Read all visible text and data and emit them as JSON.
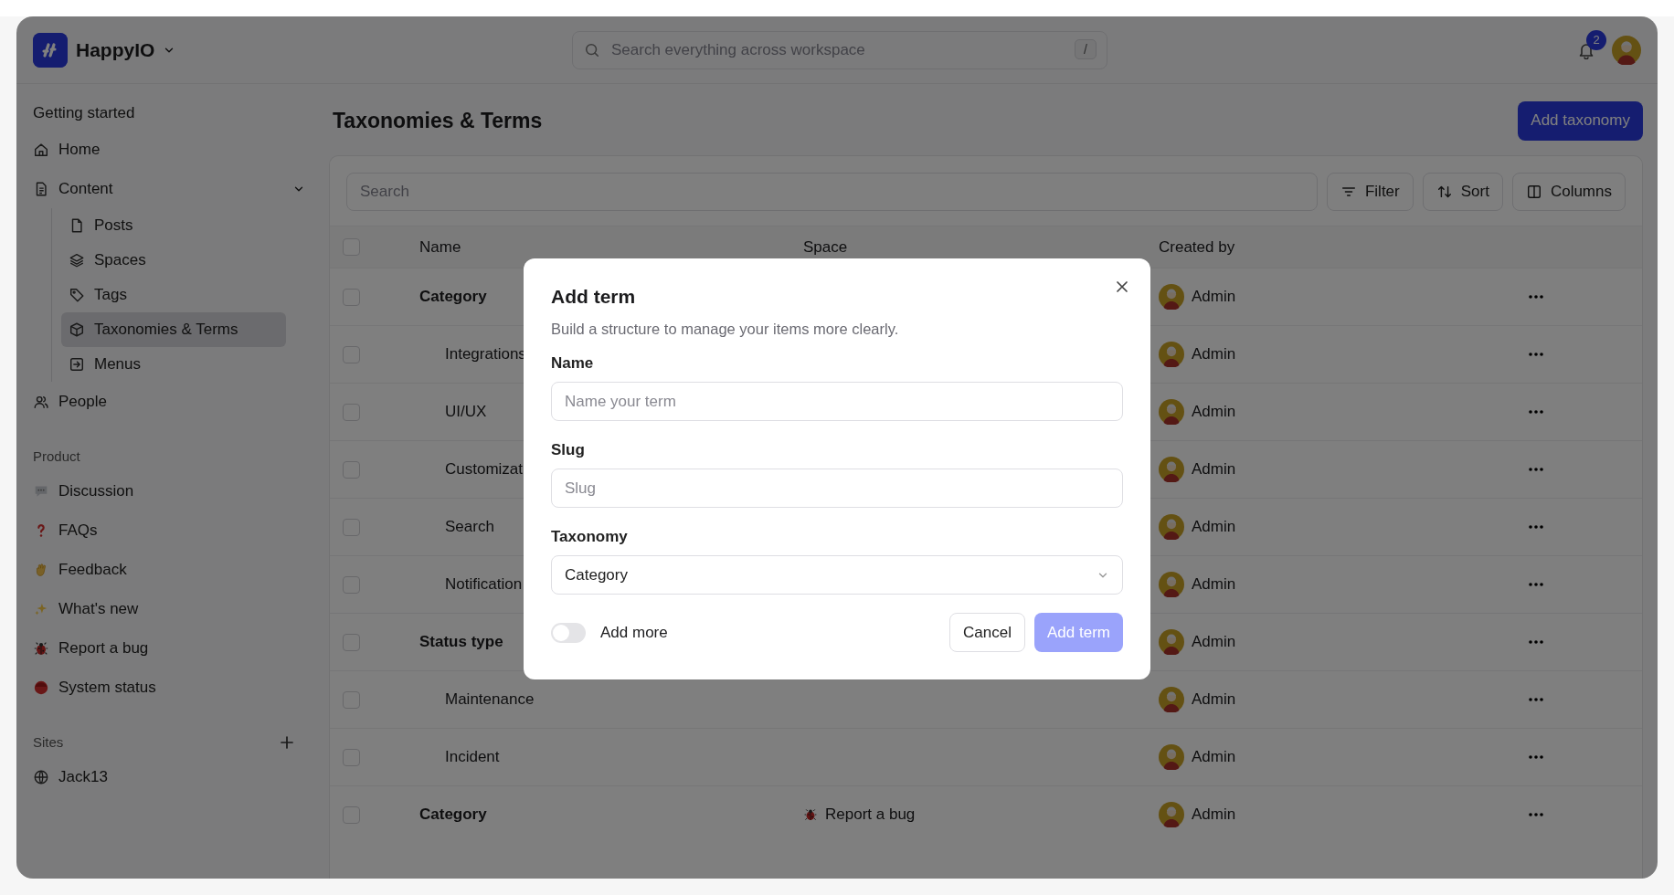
{
  "app": {
    "name": "HappyIO"
  },
  "search": {
    "placeholder": "Search everything across workspace",
    "shortcut": "/"
  },
  "notifications": {
    "count": "2"
  },
  "sidebar": {
    "sections": [
      {
        "title": "Getting started",
        "addable": false,
        "items": [
          {
            "label": "Home",
            "selected": false
          },
          {
            "label": "Content",
            "selected": false,
            "expanded": true,
            "children": [
              {
                "label": "Posts",
                "selected": false
              },
              {
                "label": "Spaces",
                "selected": false
              },
              {
                "label": "Tags",
                "selected": false
              },
              {
                "label": "Taxonomies & Terms",
                "selected": true
              },
              {
                "label": "Menus",
                "selected": false
              }
            ]
          },
          {
            "label": "People",
            "selected": false
          }
        ]
      },
      {
        "title": "Product",
        "addable": false,
        "items": [
          {
            "label": "Discussion",
            "selected": false
          },
          {
            "label": "FAQs",
            "selected": false
          },
          {
            "label": "Feedback",
            "selected": false
          },
          {
            "label": "What's new",
            "selected": false
          },
          {
            "label": "Report a bug",
            "selected": false
          },
          {
            "label": "System status",
            "selected": false
          }
        ]
      },
      {
        "title": "Sites",
        "addable": true,
        "items": [
          {
            "label": "Jack13",
            "selected": false
          }
        ]
      }
    ]
  },
  "page": {
    "title": "Taxonomies & Terms",
    "primary_button": "Add taxonomy"
  },
  "toolbar": {
    "search_placeholder": "Search",
    "buttons": [
      "Filter",
      "Sort",
      "Columns"
    ]
  },
  "table": {
    "columns": [
      "Name",
      "Space",
      "Created by"
    ],
    "all_checked": false,
    "rows": [
      {
        "name": "Category",
        "checked": false,
        "created_by": "Admin",
        "children": [
          {
            "name": "Integrations",
            "checked": false,
            "created_by": "Admin"
          },
          {
            "name": "UI/UX",
            "checked": false,
            "created_by": "Admin"
          },
          {
            "name": "Customizat",
            "checked": false,
            "created_by": "Admin"
          },
          {
            "name": "Search",
            "checked": false,
            "created_by": "Admin"
          },
          {
            "name": "Notification",
            "checked": false,
            "created_by": "Admin"
          }
        ]
      },
      {
        "name": "Status type",
        "checked": false,
        "created_by": "Admin",
        "children": [
          {
            "name": "Maintenance",
            "checked": false,
            "created_by": "Admin"
          },
          {
            "name": "Incident",
            "checked": false,
            "created_by": "Admin"
          }
        ]
      },
      {
        "name": "Category",
        "checked": false,
        "created_by": "Admin",
        "space": "Report a bug"
      }
    ]
  },
  "modal": {
    "title": "Add term",
    "description": "Build a structure to manage your items more clearly.",
    "fields": [
      {
        "kind": "text",
        "label": "Name",
        "placeholder": "Name your term"
      },
      {
        "kind": "text",
        "label": "Slug",
        "placeholder": "Slug"
      },
      {
        "kind": "select",
        "label": "Taxonomy",
        "value": "Category"
      }
    ],
    "toggle": {
      "label": "Add more",
      "on": false
    },
    "cancel": "Cancel",
    "submit": {
      "label": "Add term",
      "disabled": true
    }
  }
}
